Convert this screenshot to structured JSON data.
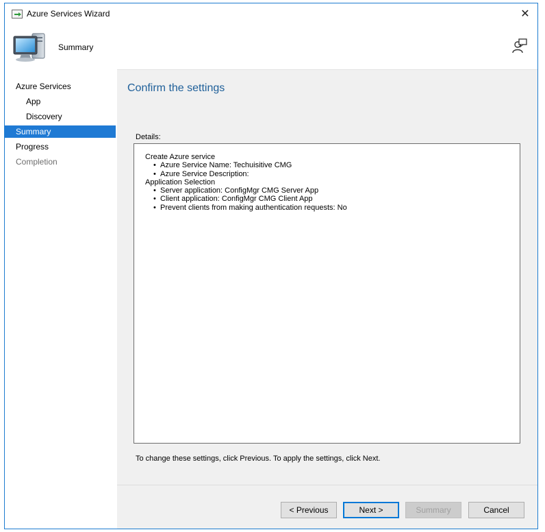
{
  "window": {
    "title": "Azure Services Wizard",
    "close_glyph": "✕"
  },
  "header": {
    "title": "Summary",
    "icon": "computer-icon",
    "help_icon": "person-help-icon"
  },
  "sidebar": {
    "items": [
      {
        "label": "Azure Services",
        "level": 0,
        "state": "normal"
      },
      {
        "label": "App",
        "level": 1,
        "state": "normal"
      },
      {
        "label": "Discovery",
        "level": 1,
        "state": "normal"
      },
      {
        "label": "Summary",
        "level": 0,
        "state": "active"
      },
      {
        "label": "Progress",
        "level": 0,
        "state": "normal"
      },
      {
        "label": "Completion",
        "level": 0,
        "state": "disabled"
      }
    ]
  },
  "main": {
    "heading": "Confirm the settings",
    "details_label": "Details:",
    "details": {
      "sections": [
        {
          "title": "Create Azure service",
          "items": [
            "Azure Service Name: Techuisitive CMG",
            "Azure Service Description:"
          ]
        },
        {
          "title": "Application Selection",
          "items": [
            "Server application: ConfigMgr CMG Server App",
            "Client application: ConfigMgr CMG Client App",
            "Prevent clients from making authentication requests: No"
          ]
        }
      ]
    },
    "footer_note": "To change these settings, click Previous. To apply the settings, click Next."
  },
  "buttons": {
    "previous": "< Previous",
    "next": "Next >",
    "summary": "Summary",
    "cancel": "Cancel"
  },
  "colors": {
    "accent": "#1f7ad4",
    "heading": "#1e5f99",
    "window_border": "#1c7bd0"
  }
}
